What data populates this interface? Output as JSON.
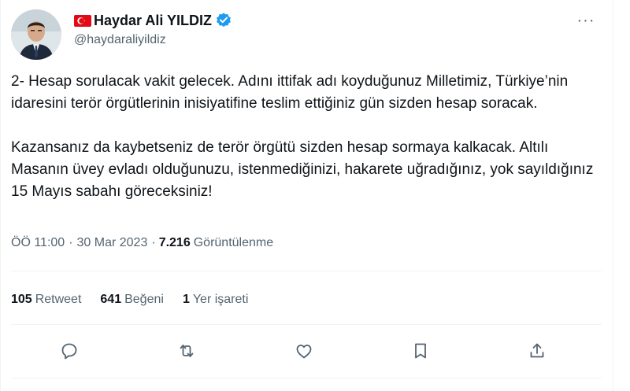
{
  "author": {
    "name": "Haydar Ali YILDIZ",
    "handle": "@haydaraliyildiz",
    "avatar_icon": "profile-photo",
    "flag_icon": "turkey-flag-icon",
    "verified_icon": "verified-badge-icon"
  },
  "more_label": "···",
  "tweet": {
    "paragraph1": "2- Hesap sorulacak vakit gelecek. Adını ittifak adı koyduğunuz Milletimiz, Türkiye’nin idaresini terör örgütlerinin inisiyatifine teslim ettiğiniz gün sizden hesap soracak.",
    "paragraph2": "Kazansanız da kaybetseniz de terör örgütü sizden hesap sormaya kalkacak. Altılı Masanın üvey evladı olduğunuzu, istenmediğinizi, hakarete uğradığınız, yok sayıldığınız 15 Mayıs sabahı göreceksiniz!"
  },
  "meta": {
    "time": "ÖÖ 11:00",
    "separator": "·",
    "date": "30 Mar 2023",
    "views_count": "7.216",
    "views_label": "Görüntülenme"
  },
  "stats": {
    "retweets_count": "105",
    "retweets_label": "Retweet",
    "likes_count": "641",
    "likes_label": "Beğeni",
    "bookmarks_count": "1",
    "bookmarks_label": "Yer işareti"
  },
  "actions": [
    "reply-icon",
    "retweet-icon",
    "like-icon",
    "bookmark-icon",
    "share-icon"
  ],
  "colors": {
    "text": "#0f1419",
    "secondary": "#536471",
    "divider": "#eff3f4",
    "verified": "#1d9bf0",
    "flag_red": "#e30a17"
  }
}
